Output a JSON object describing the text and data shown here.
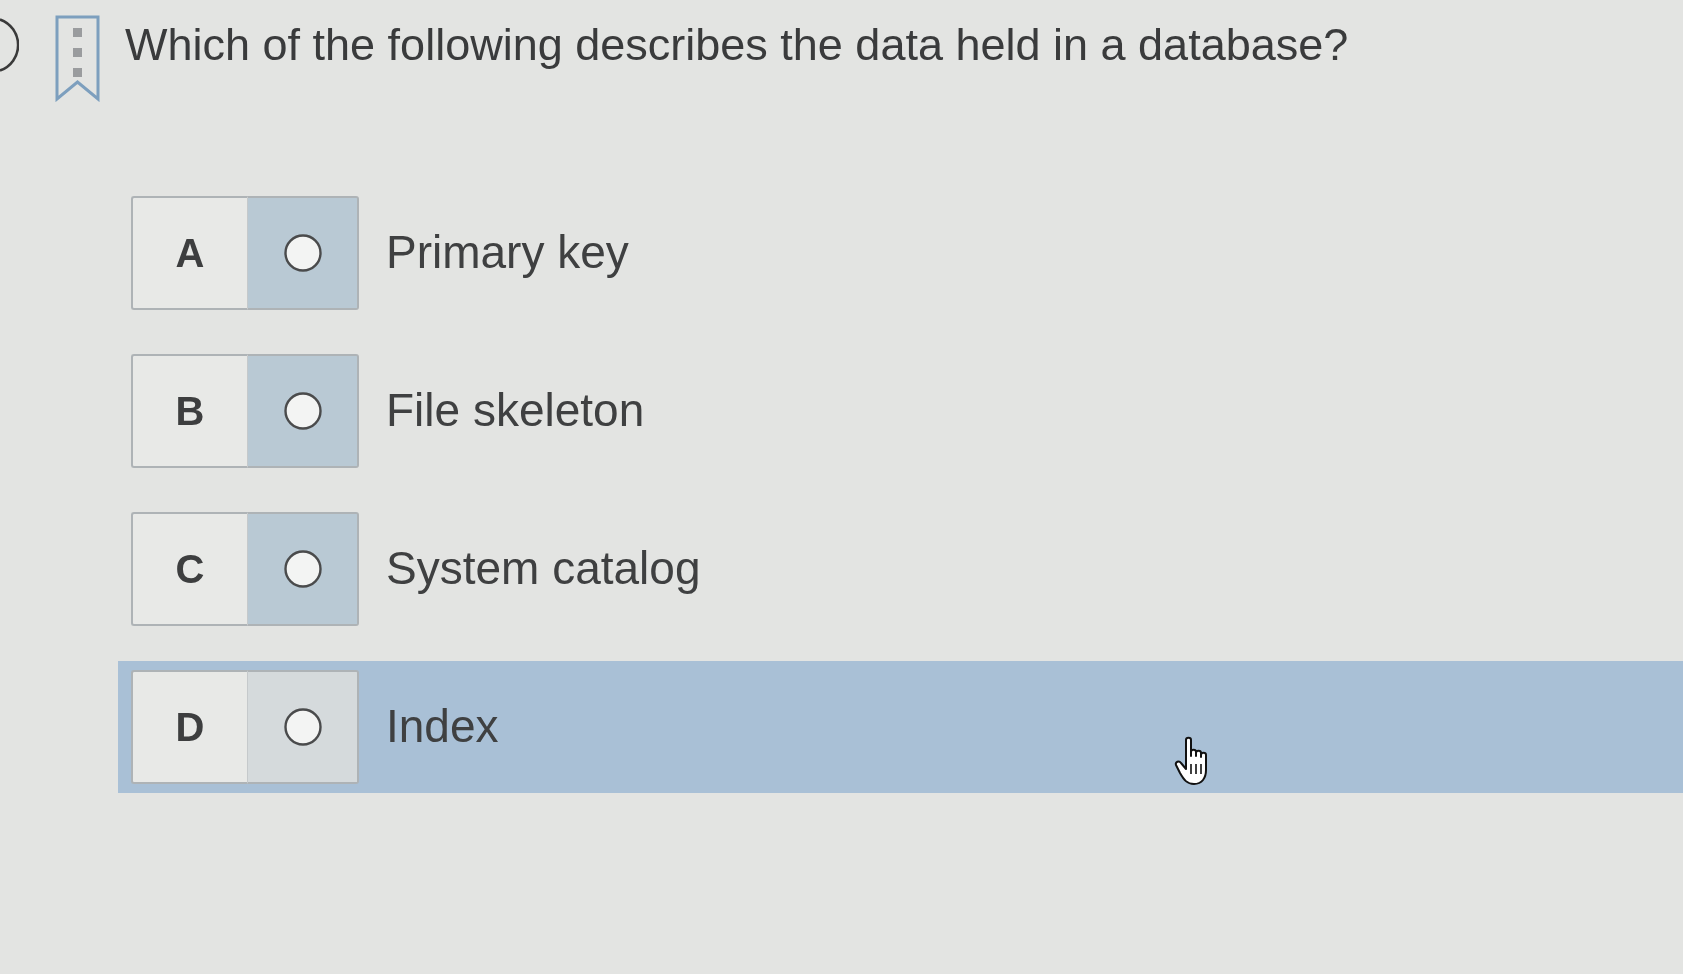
{
  "question": {
    "text": "Which of the following describes the data held in a database?"
  },
  "options": [
    {
      "letter": "A",
      "text": "Primary key",
      "checked": false,
      "highlighted": false
    },
    {
      "letter": "B",
      "text": "File skeleton",
      "checked": false,
      "highlighted": false
    },
    {
      "letter": "C",
      "text": "System catalog",
      "checked": false,
      "highlighted": false
    },
    {
      "letter": "D",
      "text": "Index",
      "checked": false,
      "highlighted": true
    }
  ]
}
